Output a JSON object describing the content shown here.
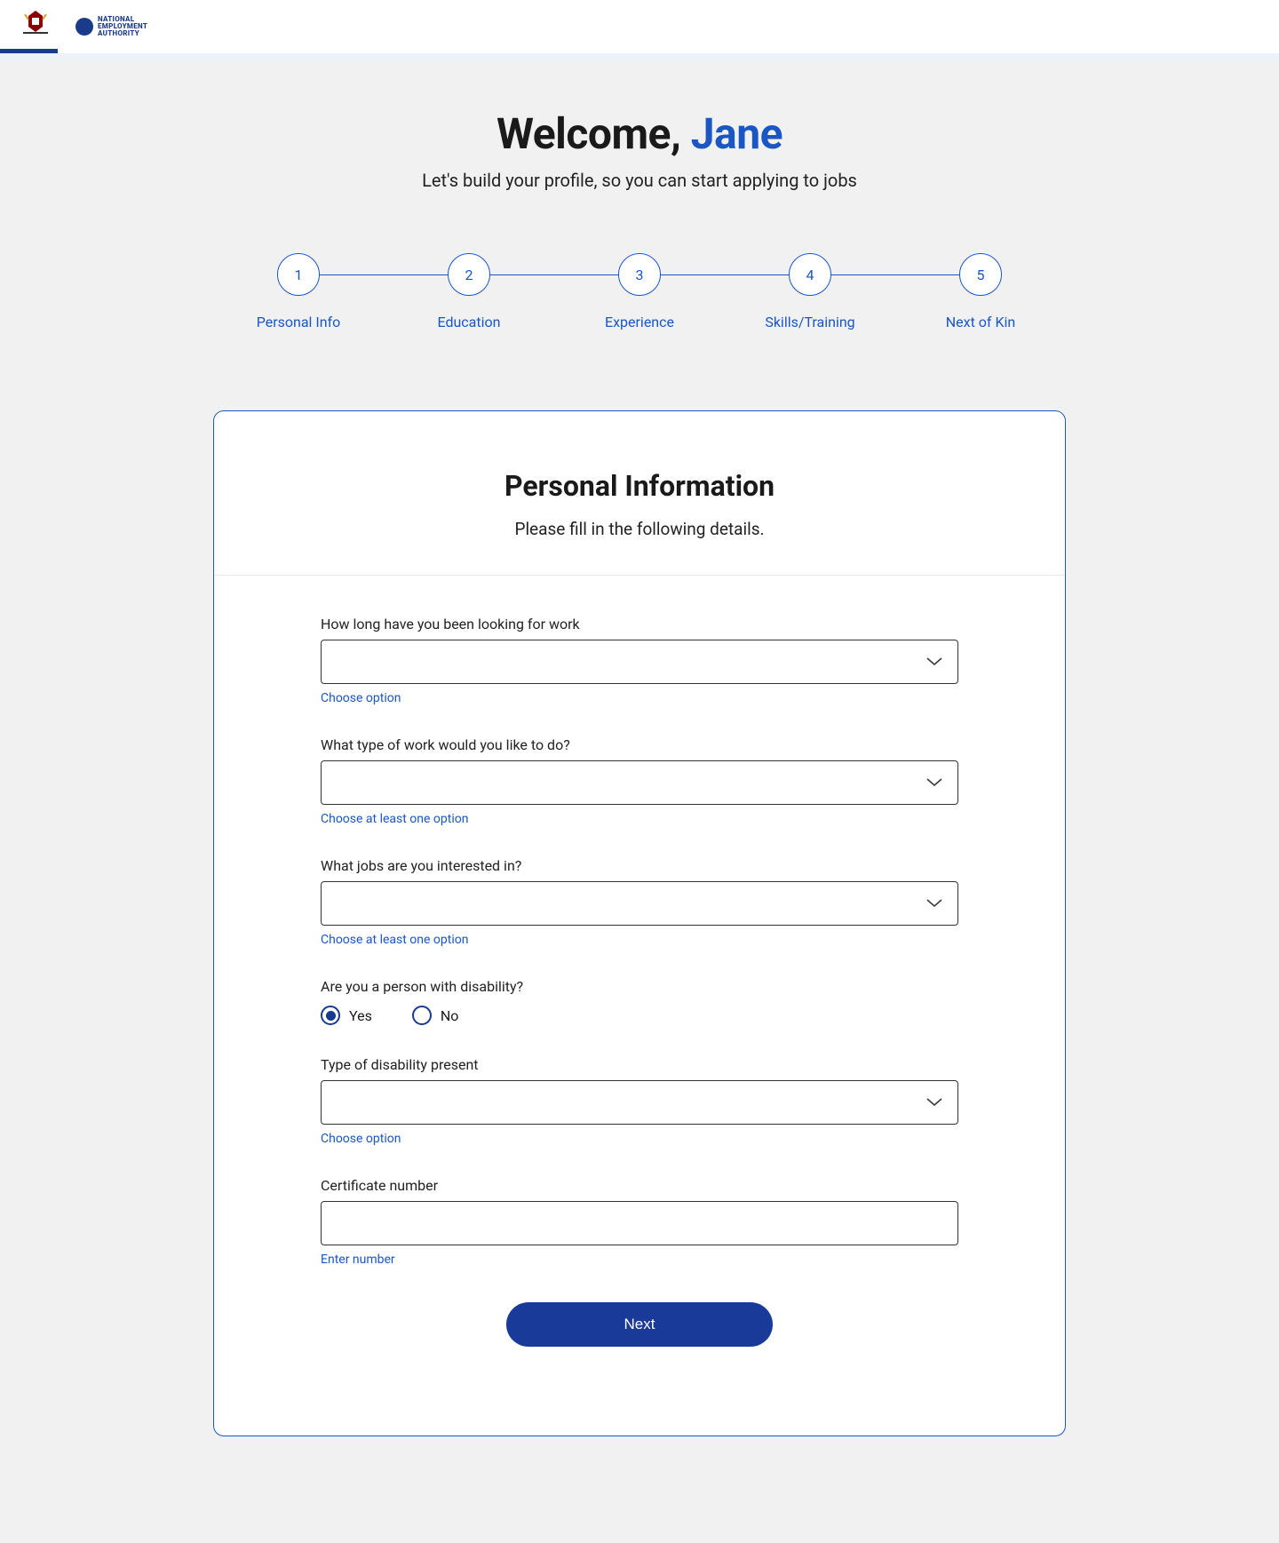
{
  "header": {
    "logo_kenya_alt": "Republic of Kenya",
    "logo_nea_lines": [
      "NATIONAL",
      "EMPLOYMENT",
      "AUTHORITY"
    ]
  },
  "welcome": {
    "prefix": "Welcome, ",
    "name": "Jane",
    "subtitle": "Let's build your profile, so you can start applying to jobs"
  },
  "stepper": [
    {
      "num": "1",
      "label": "Personal Info"
    },
    {
      "num": "2",
      "label": "Education"
    },
    {
      "num": "3",
      "label": "Experience"
    },
    {
      "num": "4",
      "label": "Skills/Training"
    },
    {
      "num": "5",
      "label": "Next of Kin"
    }
  ],
  "card": {
    "title": "Personal Information",
    "subtitle": "Please fill in the following details."
  },
  "form": {
    "duration": {
      "label": "How long have you been looking for work",
      "value": "",
      "hint": "Choose option"
    },
    "work_type": {
      "label": "What type of work would you like to do?",
      "value": "",
      "hint": "Choose at least one option"
    },
    "jobs_interest": {
      "label": "What jobs are you interested in?",
      "value": "",
      "hint": "Choose at least one option"
    },
    "disability": {
      "label": "Are you a person with disability?",
      "option_yes": "Yes",
      "option_no": "No",
      "selected": "yes"
    },
    "disability_type": {
      "label": "Type of disability present",
      "value": "",
      "hint": "Choose option"
    },
    "certificate": {
      "label": "Certificate number",
      "value": "",
      "hint": "Enter number"
    },
    "next_button": "Next"
  }
}
